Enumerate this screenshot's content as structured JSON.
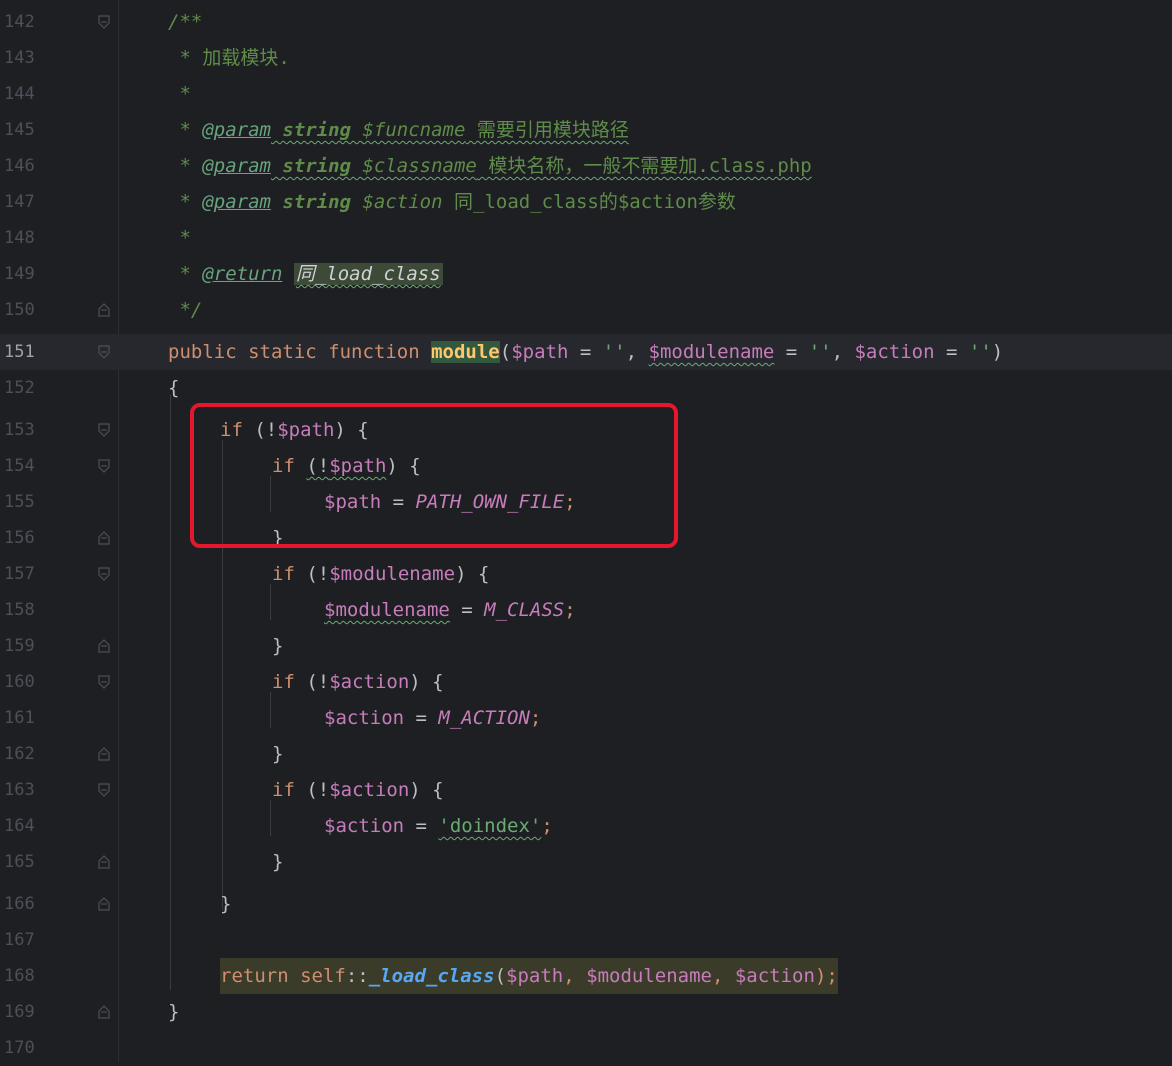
{
  "editor": {
    "current_line": "151",
    "lines": [
      {
        "n": "142",
        "text": "/**"
      },
      {
        "n": "143",
        "text": " * 加载模块."
      },
      {
        "n": "144",
        "text": " *"
      },
      {
        "n": "145",
        "a": " * ",
        "tag": "@param",
        "b": " string ",
        "v": "$funcname",
        "c": " 需要引用模块路径"
      },
      {
        "n": "146",
        "a": " * ",
        "tag": "@param",
        "b": " string ",
        "v": "$classname",
        "c": " 模块名称，一般不需要加.class.php"
      },
      {
        "n": "147",
        "a": " * ",
        "tag": "@param",
        "b": " string ",
        "v": "$action",
        "c": " 同_load_class的$action参数"
      },
      {
        "n": "148",
        "text": " *"
      },
      {
        "n": "149",
        "a": " * ",
        "tag": "@return",
        "b": " ",
        "v": "同_load_class"
      },
      {
        "n": "150",
        "text": " */"
      },
      {
        "n": "151",
        "kw": "public static function ",
        "fn": "module",
        "p1": "(",
        "v1": "$path",
        "o1": " = ",
        "s1": "''",
        "o2": ", ",
        "v2": "$modulename",
        "o3": " = ",
        "s2": "''",
        "o4": ", ",
        "v3": "$action",
        "o5": " = ",
        "s3": "''",
        "p2": ")"
      },
      {
        "n": "152",
        "text": "{"
      },
      {
        "n": "153",
        "kw": "if ",
        "p": "(!",
        "v": "$path",
        "e": ") {"
      },
      {
        "n": "154",
        "kw": "if ",
        "p": "(!",
        "v": "$path",
        "e": ") {"
      },
      {
        "n": "155",
        "v": "$path",
        "o": " = ",
        "k": "PATH_OWN_FILE",
        "e": ";"
      },
      {
        "n": "156",
        "text": "}"
      },
      {
        "n": "157",
        "kw": "if ",
        "p": "(!",
        "v": "$modulename",
        "e": ") {"
      },
      {
        "n": "158",
        "v": "$modulename",
        "o": " = ",
        "k": "M_CLASS",
        "e": ";"
      },
      {
        "n": "159",
        "text": "}"
      },
      {
        "n": "160",
        "kw": "if ",
        "p": "(!",
        "v": "$action",
        "e": ") {"
      },
      {
        "n": "161",
        "v": "$action",
        "o": " = ",
        "k": "M_ACTION",
        "e": ";"
      },
      {
        "n": "162",
        "text": "}"
      },
      {
        "n": "163",
        "kw": "if ",
        "p": "(!",
        "v": "$action",
        "e": ") {"
      },
      {
        "n": "164",
        "v": "$action",
        "o": " = ",
        "s": "'doindex'",
        "e": ";"
      },
      {
        "n": "165",
        "text": "}"
      },
      {
        "n": "166",
        "text": "}"
      },
      {
        "n": "167",
        "text": ""
      },
      {
        "n": "168",
        "kw": "return ",
        "self": "self",
        "dc": "::",
        "fn": "_load_class",
        "p1": "(",
        "v1": "$path",
        "o1": ", ",
        "v2": "$modulename",
        "o2": ", ",
        "v3": "$action",
        "p2": ");"
      },
      {
        "n": "169",
        "text": "}"
      },
      {
        "n": "170",
        "text": ""
      }
    ]
  },
  "colors": {
    "highlight_box": "#e3182d",
    "background": "#1e1f22",
    "keyword": "#cf8e6d",
    "variable": "#c77dbb",
    "string": "#6aab73",
    "comment": "#5f8c4a"
  },
  "icons": {
    "fold_open": "fold-open-icon",
    "fold_close": "fold-close-icon"
  }
}
